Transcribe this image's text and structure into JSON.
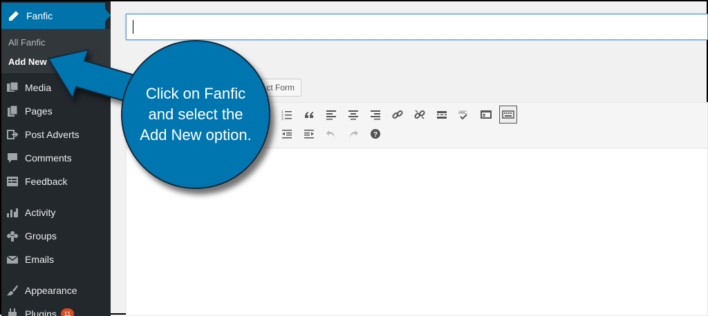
{
  "sidebar": {
    "current": {
      "label": "Fanfic",
      "icon": "pencil-icon"
    },
    "submenu": [
      {
        "label": "All Fanfic"
      },
      {
        "label": "Add New"
      }
    ],
    "items": [
      {
        "label": "Media",
        "icon": "media-icon"
      },
      {
        "label": "Pages",
        "icon": "pages-icon"
      },
      {
        "label": "Post Adverts",
        "icon": "post-adverts-icon"
      },
      {
        "label": "Comments",
        "icon": "comments-icon"
      },
      {
        "label": "Feedback",
        "icon": "feedback-icon"
      },
      {
        "label": "Activity",
        "icon": "activity-icon"
      },
      {
        "label": "Groups",
        "icon": "groups-icon"
      },
      {
        "label": "Emails",
        "icon": "emails-icon"
      },
      {
        "label": "Appearance",
        "icon": "appearance-icon"
      },
      {
        "label": "Plugins",
        "icon": "plugins-icon",
        "badge": "11"
      }
    ]
  },
  "editor": {
    "title_value": "",
    "contact_form_label": "ct Form"
  },
  "callout": {
    "text": "Click on Fanfic and select the Add New option."
  },
  "colors": {
    "sidebar_bg": "#23282d",
    "accent": "#0073aa",
    "callout": "#0076b0"
  }
}
